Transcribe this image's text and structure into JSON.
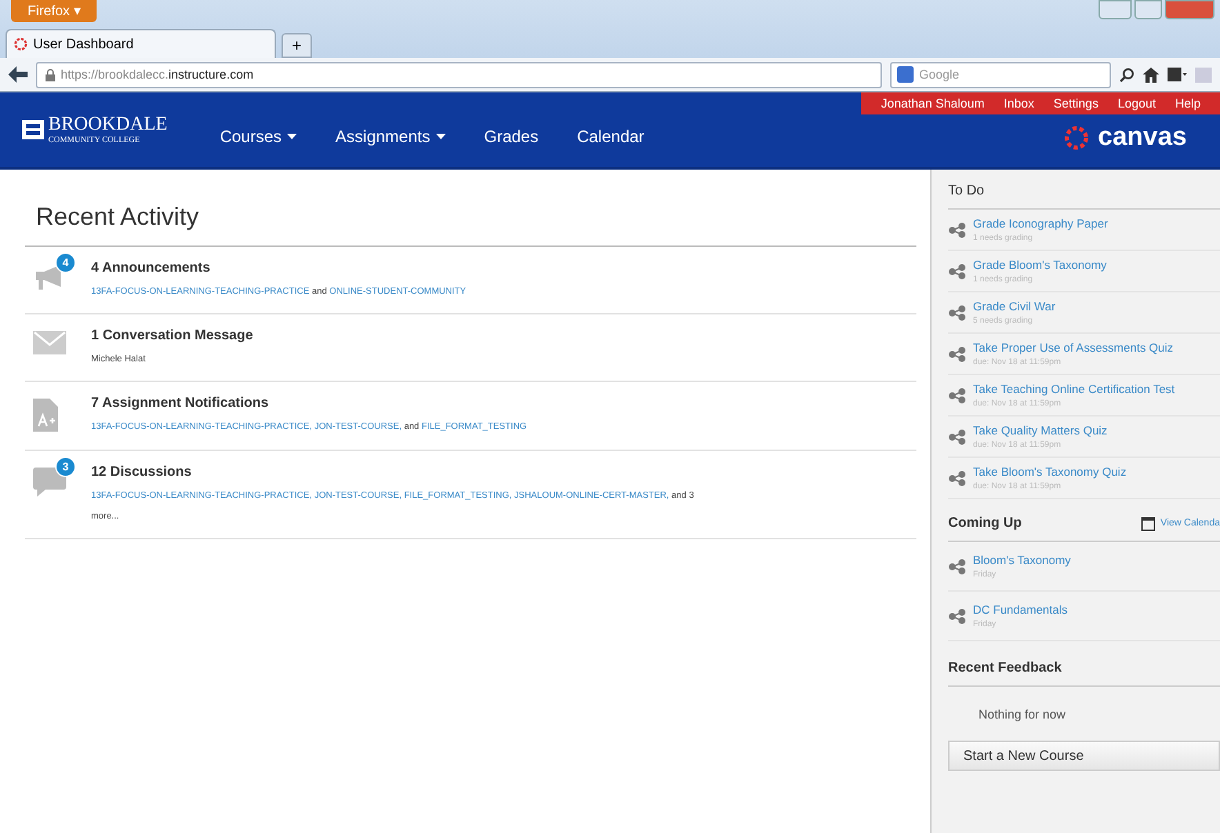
{
  "browser": {
    "menu_button": "Firefox ▾",
    "tab_title": "User Dashboard",
    "new_tab": "+",
    "url_prefix": "https://brookdalecc.",
    "url_domain": "instructure.com",
    "search_placeholder": "Google"
  },
  "header": {
    "logo_main": "BROOKDALE",
    "logo_sub": "COMMUNITY COLLEGE",
    "nav": [
      {
        "label": "Courses",
        "dropdown": true
      },
      {
        "label": "Assignments",
        "dropdown": true
      },
      {
        "label": "Grades",
        "dropdown": false
      },
      {
        "label": "Calendar",
        "dropdown": false
      }
    ],
    "user_links": [
      "Jonathan Shaloum",
      "Inbox",
      "Settings",
      "Logout",
      "Help"
    ],
    "brand": "canvas"
  },
  "recent_activity": {
    "title": "Recent Activity",
    "items": [
      {
        "kind": "announcement",
        "badge": "4",
        "title": "4 Announcements",
        "links": [
          "13FA-FOCUS-ON-LEARNING-TEACHING-PRACTICE",
          "ONLINE-STUDENT-COMMUNITY"
        ],
        "tail": "and"
      },
      {
        "kind": "message",
        "title": "1 Conversation Message",
        "plain": "Michele Halat"
      },
      {
        "kind": "assignment",
        "title": "7 Assignment Notifications",
        "links": [
          "13FA-FOCUS-ON-LEARNING-TEACHING-PRACTICE,",
          "JON-TEST-COURSE,",
          "FILE_FORMAT_TESTING"
        ],
        "tail": "and"
      },
      {
        "kind": "discussion",
        "badge": "3",
        "title": "12 Discussions",
        "links": [
          "13FA-FOCUS-ON-LEARNING-TEACHING-PRACTICE,",
          "JON-TEST-COURSE,",
          "FILE_FORMAT_TESTING,",
          "JSHALOUM-ONLINE-CERT-MASTER,"
        ],
        "tail": "and 3 more..."
      }
    ]
  },
  "todo": {
    "title": "To Do",
    "items": [
      {
        "title": "Grade Iconography Paper",
        "sub": "1 needs grading"
      },
      {
        "title": "Grade Bloom's Taxonomy",
        "sub": "1 needs grading"
      },
      {
        "title": "Grade Civil War",
        "sub": "5 needs grading"
      },
      {
        "title": "Take Proper Use of Assessments Quiz",
        "sub": "due: Nov 18 at 11:59pm"
      },
      {
        "title": "Take Teaching Online Certification Test",
        "sub": "due: Nov 18 at 11:59pm"
      },
      {
        "title": "Take Quality Matters Quiz",
        "sub": "due: Nov 18 at 11:59pm"
      },
      {
        "title": "Take Bloom's Taxonomy Quiz",
        "sub": "due: Nov 18 at 11:59pm"
      }
    ]
  },
  "coming_up": {
    "title": "Coming Up",
    "view_calendar": "View Calenda",
    "items": [
      {
        "title": "Bloom's Taxonomy",
        "sub": "Friday"
      },
      {
        "title": "DC Fundamentals",
        "sub": "Friday"
      }
    ]
  },
  "recent_feedback": {
    "title": "Recent Feedback",
    "empty": "Nothing for now"
  },
  "start_course": "Start a New Course"
}
